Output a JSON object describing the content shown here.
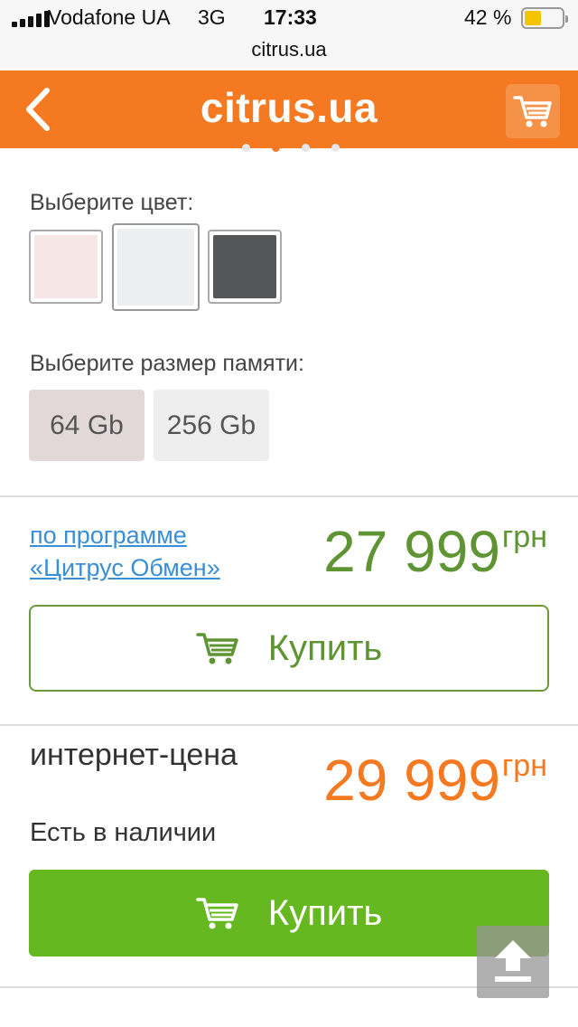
{
  "status_bar": {
    "carrier": "Vodafone UA",
    "network": "3G",
    "time": "17:33",
    "battery": "42 %",
    "url": "citrus.ua"
  },
  "header": {
    "logo": "citrus.ua",
    "back_icon": "chevron-left-icon",
    "cart_icon": "cart-icon",
    "color": "#f47920"
  },
  "carousel": {
    "dots": 4,
    "active": 1
  },
  "color_picker": {
    "label": "Выберите цвет:",
    "options": [
      {
        "name": "pink",
        "color": "#f7e6e6",
        "selected": false
      },
      {
        "name": "silver",
        "color": "#eceef0",
        "selected": true
      },
      {
        "name": "space-gray",
        "color": "#55565a",
        "selected": false
      }
    ]
  },
  "memory_picker": {
    "label": "Выберите размер памяти:",
    "options": [
      {
        "label": "64 Gb",
        "selected": true
      },
      {
        "label": "256 Gb",
        "selected": false
      }
    ]
  },
  "exchange": {
    "link_line1": "по программе",
    "link_line2": "«Цитрус Обмен»",
    "price": "27 999",
    "currency": "грн",
    "price_color": "#5f9434",
    "buy_label": "Купить"
  },
  "internet_price": {
    "label": "интернет-цена",
    "price": "29 999",
    "currency": "грн",
    "price_color": "#f47920",
    "stock": "Есть в наличии",
    "buy_label": "Купить",
    "button_color": "#66b820"
  },
  "scroll_top": {
    "icon": "upload-arrow-icon"
  }
}
